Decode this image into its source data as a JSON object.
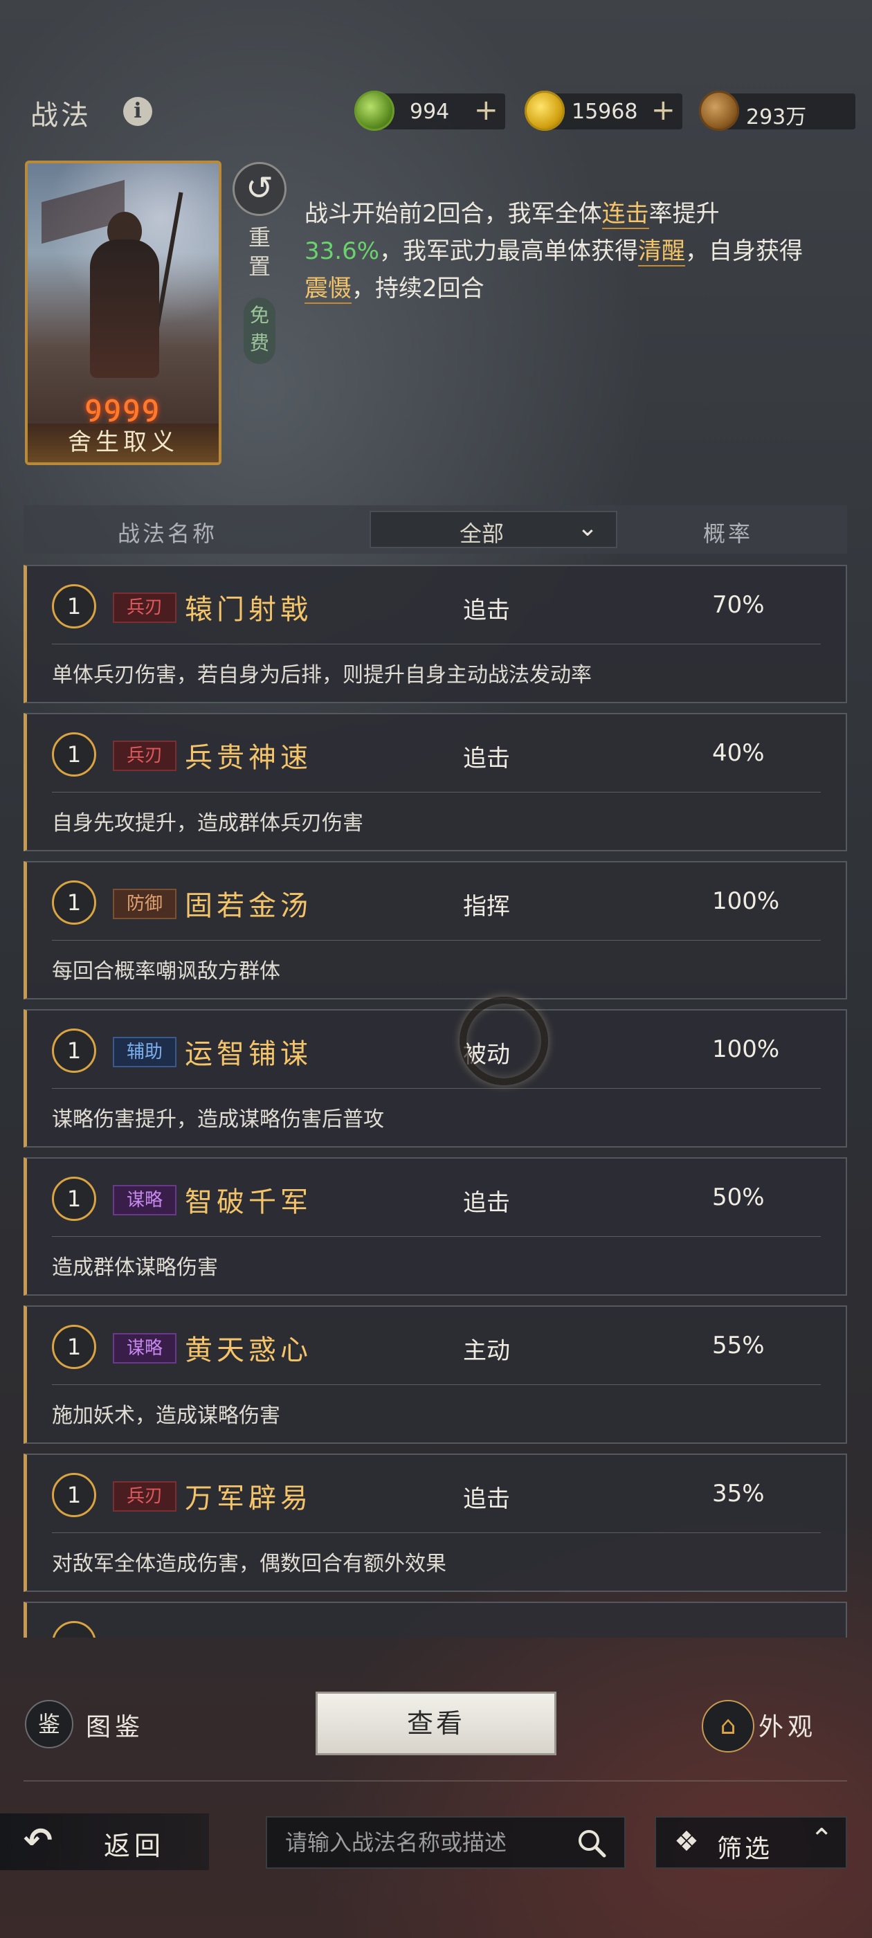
{
  "header": {
    "title": "战法",
    "info_icon": "info-icon",
    "currencies": [
      {
        "icon": "jade-coin-icon",
        "value": "994",
        "plus": "+",
        "color": "#7fb83a"
      },
      {
        "icon": "gold-coin-icon",
        "value": "15968",
        "plus": "+",
        "color": "#e1b21e"
      },
      {
        "icon": "copper-coin-icon",
        "value": "293万",
        "color": "#a0783a"
      }
    ]
  },
  "card": {
    "stars": "ꝯꝯꝯꝯ",
    "name": "舍生取义"
  },
  "reset": {
    "icon": "reset-icon",
    "label": "重置",
    "free": "免费"
  },
  "description": {
    "p1": "战斗开始前2回合，我军全体",
    "h1": "连击",
    "p2": "率提升",
    "g1": "33.6%",
    "p3": "，我军武力最高单体获得",
    "h2": "清醒",
    "p4": "，自身获得",
    "h3": "震慑",
    "p5": "，持续2回合"
  },
  "table_header": {
    "name_col": "战法名称",
    "filter": "全部",
    "rate_col": "概率"
  },
  "skills": [
    {
      "level": "1",
      "tag": "兵刃",
      "tag_color": "red",
      "name": "辕门射戟",
      "type": "追击",
      "rate": "70%",
      "desc": "单体兵刃伤害，若自身为后排，则提升自身主动战法发动率"
    },
    {
      "level": "1",
      "tag": "兵刃",
      "tag_color": "red",
      "name": "兵贵神速",
      "type": "追击",
      "rate": "40%",
      "desc": "自身先攻提升，造成群体兵刃伤害"
    },
    {
      "level": "1",
      "tag": "防御",
      "tag_color": "brown",
      "name": "固若金汤",
      "type": "指挥",
      "rate": "100%",
      "desc": "每回合概率嘲讽敌方群体"
    },
    {
      "level": "1",
      "tag": "辅助",
      "tag_color": "blue",
      "name": "运智铺谋",
      "type": "被动",
      "rate": "100%",
      "desc": "谋略伤害提升，造成谋略伤害后普攻"
    },
    {
      "level": "1",
      "tag": "谋略",
      "tag_color": "purple",
      "name": "智破千军",
      "type": "追击",
      "rate": "50%",
      "desc": "造成群体谋略伤害"
    },
    {
      "level": "1",
      "tag": "谋略",
      "tag_color": "purple",
      "name": "黄天惑心",
      "type": "主动",
      "rate": "55%",
      "desc": "施加妖术，造成谋略伤害"
    },
    {
      "level": "1",
      "tag": "兵刃",
      "tag_color": "red",
      "name": "万军辟易",
      "type": "追击",
      "rate": "35%",
      "desc": "对敌军全体造成伤害，偶数回合有额外效果"
    }
  ],
  "bottom": {
    "book_label": "图鉴",
    "book_icon": "book-icon",
    "view_label": "查看",
    "look_label": "外观",
    "look_icon": "pavilion-icon",
    "back_label": "返回",
    "back_icon": "back-arrow-icon",
    "search_placeholder": "请输入战法名称或描述",
    "search_icon": "search-icon",
    "filter_label": "筛选",
    "filter_icon": "diamond-grid-icon",
    "filter_chevron": "chevron-up-icon"
  }
}
